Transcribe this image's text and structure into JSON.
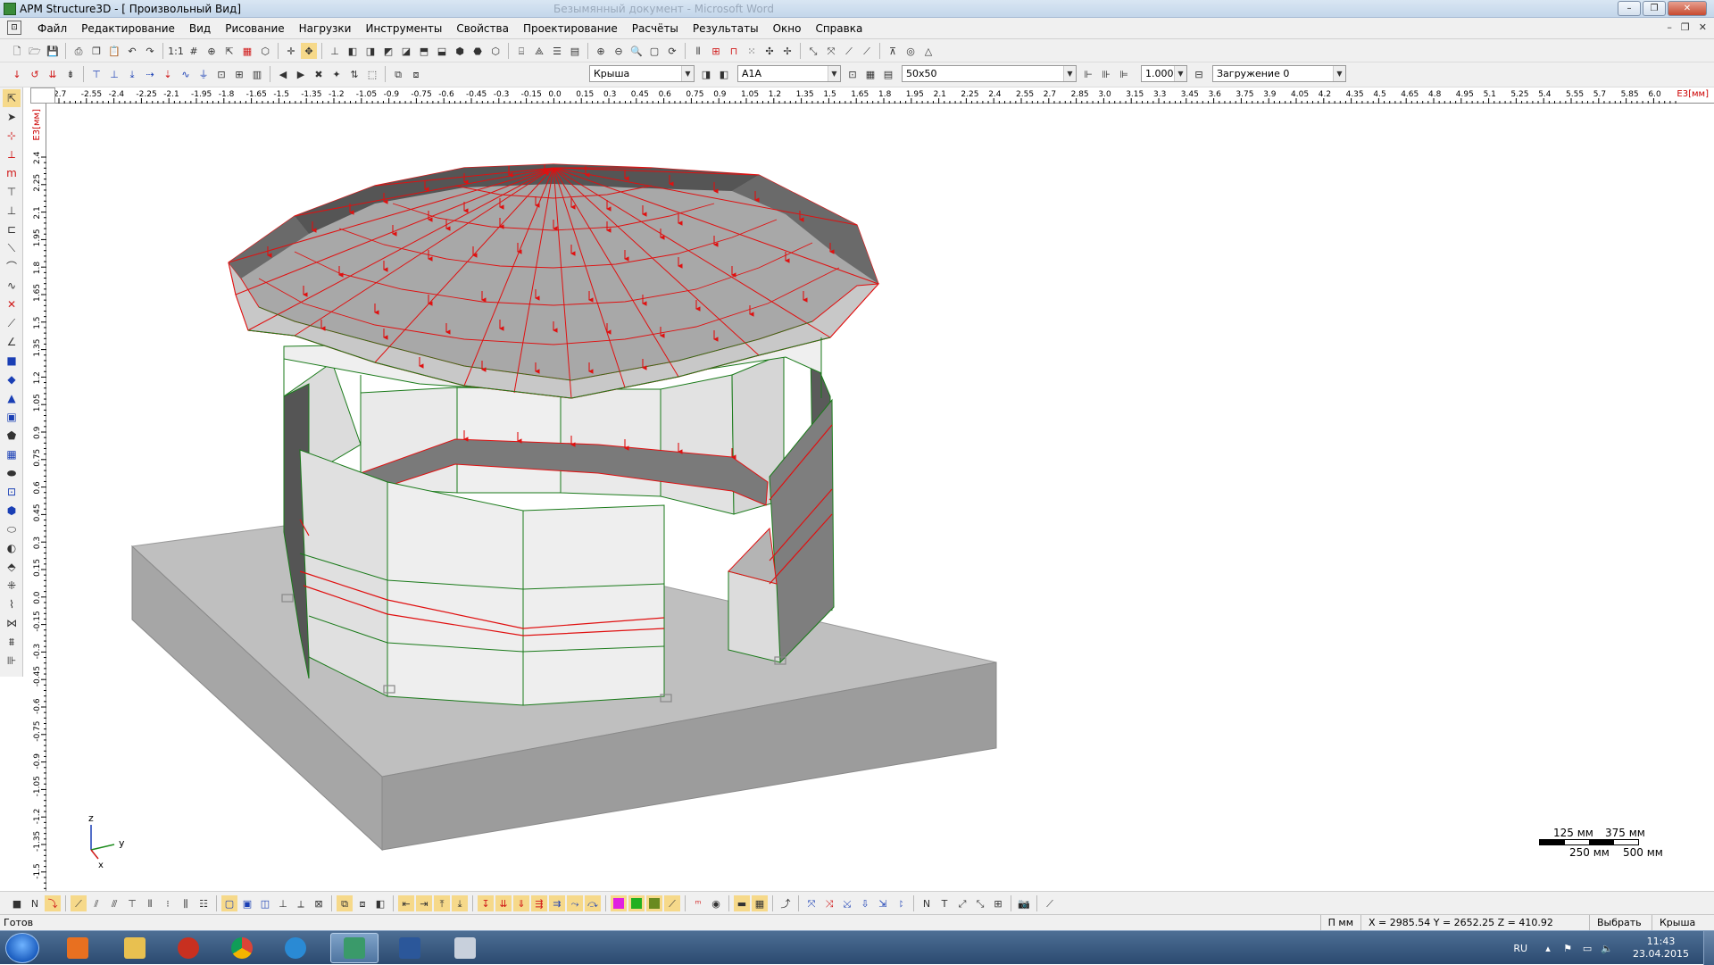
{
  "window": {
    "title": "APM Structure3D - [ Произвольный Вид]",
    "background_title": "Безымянный документ - Microsoft Word",
    "controls": [
      "–",
      "❐",
      "✕"
    ]
  },
  "menu": {
    "items": [
      "Файл",
      "Редактирование",
      "Вид",
      "Рисование",
      "Нагрузки",
      "Инструменты",
      "Свойства",
      "Проектирование",
      "Расчёты",
      "Результаты",
      "Окно",
      "Справка"
    ],
    "mdi_controls": [
      "–",
      "❐",
      "✕"
    ]
  },
  "toolbar2": {
    "layer_combo": "Крыша",
    "section_combo": "A1A",
    "grid_combo": "50x50",
    "scale_combo": "1.0000",
    "load_combo": "Загружение 0"
  },
  "ruler": {
    "top_ticks": [
      "2.7",
      "-2.55",
      "-2.4",
      "-2.25",
      "-2.1",
      "-1.95",
      "-1.8",
      "-1.65",
      "-1.5",
      "-1.35",
      "-1.2",
      "-1.05",
      "-0.9",
      "-0.75",
      "-0.6",
      "-0.45",
      "-0.3",
      "-0.15",
      "0.0",
      "0.15",
      "0.3",
      "0.45",
      "0.6",
      "0.75",
      "0.9",
      "1.05",
      "1.2",
      "1.35",
      "1.5",
      "1.65",
      "1.8",
      "1.95",
      "2.1",
      "2.25",
      "2.4",
      "2.55",
      "2.7",
      "2.85",
      "3.0",
      "3.15",
      "3.3",
      "3.45",
      "3.6",
      "3.75",
      "3.9",
      "4.05",
      "4.2",
      "4.35",
      "4.5",
      "4.65",
      "4.8",
      "4.95",
      "5.1",
      "5.25",
      "5.4",
      "5.55",
      "5.7",
      "5.85",
      "6.0"
    ],
    "top_unit": "E3[мм]",
    "left_ticks": [
      "2.4",
      "2.25",
      "2.1",
      "1.95",
      "1.8",
      "1.65",
      "1.5",
      "1.35",
      "1.2",
      "1.05",
      "0.9",
      "0.75",
      "0.6",
      "0.45",
      "0.3",
      "0.15",
      "0.0",
      "-0.15",
      "-0.3",
      "-0.45",
      "-0.6",
      "-0.75",
      "-0.9",
      "-1.05",
      "-1.2",
      "-1.35",
      "-1.5"
    ],
    "left_unit": "E3[мм]"
  },
  "axes": {
    "z": "z",
    "y": "y",
    "x": "x"
  },
  "scale_bar": {
    "top_left": "125 мм",
    "top_right": "375 мм",
    "bottom_left": "250 мм",
    "bottom_right": "500 мм"
  },
  "status": {
    "ready": "Готов",
    "units": "П  мм",
    "coords": "X = 2985.54 Y = 2652.25 Z = 410.92",
    "mode": "Выбрать",
    "layer": "Крыша"
  },
  "taskbar": {
    "lang": "RU",
    "time": "11:43",
    "date": "23.04.2015",
    "apps": [
      "media-player",
      "file-explorer",
      "ccleaner",
      "chrome",
      "internet-explorer",
      "apm-structure3d",
      "word",
      "calculator"
    ]
  },
  "colors": {
    "load_red": "#e01010",
    "edge_green": "#1a7a1a",
    "roof_gray": "#a8a8a8",
    "wall_light": "#e6e6e6",
    "slab_gray": "#8c8c8c"
  }
}
